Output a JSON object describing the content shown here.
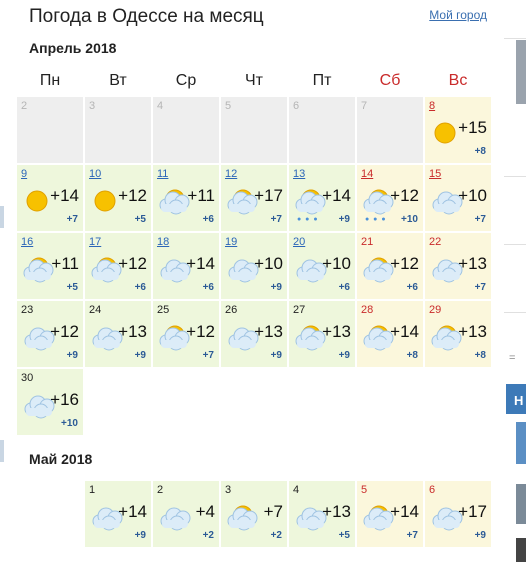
{
  "title": "Погода в Одессе на месяц",
  "my_city_link": "Мой город",
  "weekdays": [
    {
      "label": "Пн",
      "weekend": false
    },
    {
      "label": "Вт",
      "weekend": false
    },
    {
      "label": "Ср",
      "weekend": false
    },
    {
      "label": "Чт",
      "weekend": false
    },
    {
      "label": "Пт",
      "weekend": false
    },
    {
      "label": "Сб",
      "weekend": true
    },
    {
      "label": "Вс",
      "weekend": true
    }
  ],
  "months": [
    {
      "name": "Апрель 2018",
      "weeks": [
        [
          {
            "day": "2",
            "past": true
          },
          {
            "day": "3",
            "past": true
          },
          {
            "day": "4",
            "past": true
          },
          {
            "day": "5",
            "past": true
          },
          {
            "day": "6",
            "past": true
          },
          {
            "day": "7",
            "past": true
          },
          {
            "day": "8",
            "high": "+15",
            "low": "+8",
            "icon": "sun-icon",
            "link": true,
            "weekend": true
          }
        ],
        [
          {
            "day": "9",
            "high": "+14",
            "low": "+7",
            "icon": "sun-icon",
            "link": true
          },
          {
            "day": "10",
            "high": "+12",
            "low": "+5",
            "icon": "sun-icon",
            "link": true
          },
          {
            "day": "11",
            "high": "+11",
            "low": "+6",
            "icon": "partly-cloudy-icon",
            "link": true
          },
          {
            "day": "12",
            "high": "+17",
            "low": "+7",
            "icon": "partly-cloudy-icon",
            "link": true
          },
          {
            "day": "13",
            "high": "+14",
            "low": "+9",
            "icon": "partly-cloudy-icon",
            "link": true,
            "rain": true
          },
          {
            "day": "14",
            "high": "+12",
            "low": "+10",
            "icon": "partly-cloudy-icon",
            "link": true,
            "weekend": true,
            "rain": true
          },
          {
            "day": "15",
            "high": "+10",
            "low": "+7",
            "icon": "cloudy-icon",
            "link": true,
            "weekend": true
          }
        ],
        [
          {
            "day": "16",
            "high": "+11",
            "low": "+5",
            "icon": "partly-cloudy-icon",
            "link": true
          },
          {
            "day": "17",
            "high": "+12",
            "low": "+6",
            "icon": "partly-cloudy-icon",
            "link": true
          },
          {
            "day": "18",
            "high": "+14",
            "low": "+6",
            "icon": "cloudy-icon",
            "link": true
          },
          {
            "day": "19",
            "high": "+10",
            "low": "+9",
            "icon": "cloudy-icon",
            "link": true
          },
          {
            "day": "20",
            "high": "+10",
            "low": "+6",
            "icon": "cloudy-icon",
            "link": true
          },
          {
            "day": "21",
            "high": "+12",
            "low": "+6",
            "icon": "partly-cloudy-icon",
            "weekend": true
          },
          {
            "day": "22",
            "high": "+13",
            "low": "+7",
            "icon": "cloudy-icon",
            "weekend": true
          }
        ],
        [
          {
            "day": "23",
            "high": "+12",
            "low": "+9",
            "icon": "cloudy-icon"
          },
          {
            "day": "24",
            "high": "+13",
            "low": "+9",
            "icon": "cloudy-icon"
          },
          {
            "day": "25",
            "high": "+12",
            "low": "+7",
            "icon": "partly-cloudy-icon"
          },
          {
            "day": "26",
            "high": "+13",
            "low": "+9",
            "icon": "cloudy-icon"
          },
          {
            "day": "27",
            "high": "+13",
            "low": "+9",
            "icon": "partly-cloudy-icon"
          },
          {
            "day": "28",
            "high": "+14",
            "low": "+8",
            "icon": "partly-cloudy-icon",
            "weekend": true
          },
          {
            "day": "29",
            "high": "+13",
            "low": "+8",
            "icon": "partly-cloudy-icon",
            "weekend": true
          }
        ],
        [
          {
            "day": "30",
            "high": "+16",
            "low": "+10",
            "icon": "cloudy-icon"
          }
        ]
      ]
    },
    {
      "name": "Май 2018",
      "weeks": [
        [
          null,
          {
            "day": "1",
            "high": "+14",
            "low": "+9",
            "icon": "cloudy-icon"
          },
          {
            "day": "2",
            "high": "+4",
            "low": "+2",
            "icon": "cloudy-icon"
          },
          {
            "day": "3",
            "high": "+7",
            "low": "+2",
            "icon": "partly-cloudy-icon"
          },
          {
            "day": "4",
            "high": "+13",
            "low": "+5",
            "icon": "cloudy-icon"
          },
          {
            "day": "5",
            "high": "+14",
            "low": "+7",
            "icon": "partly-cloudy-icon",
            "weekend": true
          },
          {
            "day": "6",
            "high": "+17",
            "low": "+9",
            "icon": "cloudy-icon",
            "weekend": true
          }
        ]
      ]
    }
  ],
  "sidebar_header": "Н",
  "sidebar_scroll": "="
}
